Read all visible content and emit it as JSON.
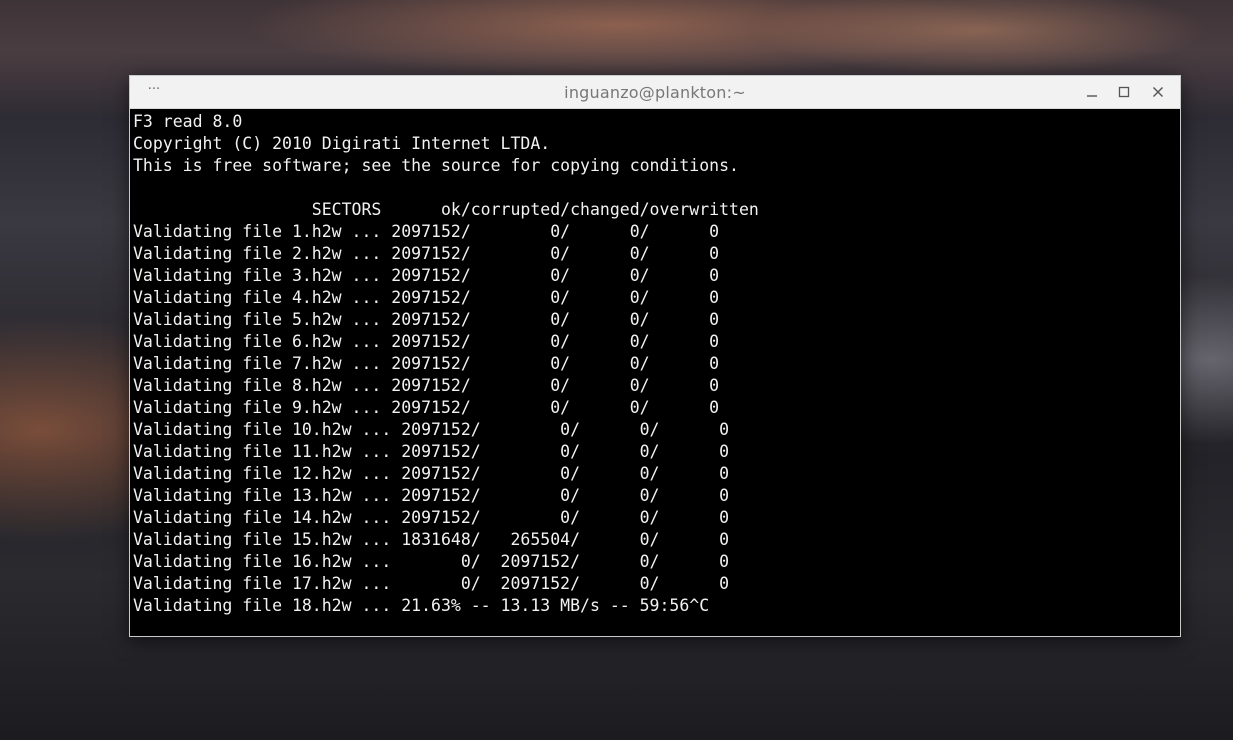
{
  "window": {
    "title": "inguanzo@plankton:~",
    "menu_glyph": "···"
  },
  "terminal": {
    "lines": [
      "F3 read 8.0",
      "Copyright (C) 2010 Digirati Internet LTDA.",
      "This is free software; see the source for copying conditions.",
      "",
      "                  SECTORS      ok/corrupted/changed/overwritten",
      "Validating file 1.h2w ... 2097152/        0/      0/      0",
      "Validating file 2.h2w ... 2097152/        0/      0/      0",
      "Validating file 3.h2w ... 2097152/        0/      0/      0",
      "Validating file 4.h2w ... 2097152/        0/      0/      0",
      "Validating file 5.h2w ... 2097152/        0/      0/      0",
      "Validating file 6.h2w ... 2097152/        0/      0/      0",
      "Validating file 7.h2w ... 2097152/        0/      0/      0",
      "Validating file 8.h2w ... 2097152/        0/      0/      0",
      "Validating file 9.h2w ... 2097152/        0/      0/      0",
      "Validating file 10.h2w ... 2097152/        0/      0/      0",
      "Validating file 11.h2w ... 2097152/        0/      0/      0",
      "Validating file 12.h2w ... 2097152/        0/      0/      0",
      "Validating file 13.h2w ... 2097152/        0/      0/      0",
      "Validating file 14.h2w ... 2097152/        0/      0/      0",
      "Validating file 15.h2w ... 1831648/   265504/      0/      0",
      "Validating file 16.h2w ...       0/  2097152/      0/      0",
      "Validating file 17.h2w ...       0/  2097152/      0/      0",
      "Validating file 18.h2w ... 21.63% -- 13.13 MB/s -- 59:56^C"
    ]
  }
}
